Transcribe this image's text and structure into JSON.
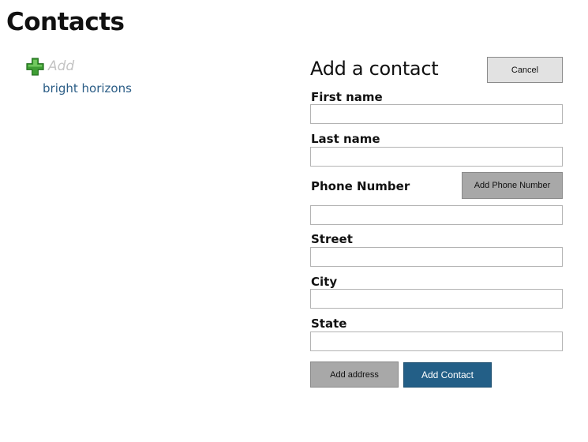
{
  "page": {
    "title": "Contacts"
  },
  "sidebar": {
    "add_label": "Add",
    "contacts": [
      "bright horizons"
    ]
  },
  "form": {
    "title": "Add a contact",
    "cancel_label": "Cancel",
    "first_name_label": "First name",
    "first_name_value": "",
    "last_name_label": "Last name",
    "last_name_value": "",
    "phone_label": "Phone Number",
    "phone_value": "",
    "add_phone_label": "Add Phone Number",
    "street_label": "Street",
    "street_value": "",
    "city_label": "City",
    "city_value": "",
    "state_label": "State",
    "state_value": "",
    "add_address_label": "Add address",
    "add_contact_label": "Add Contact"
  },
  "colors": {
    "link": "#2b5d86",
    "primary_button": "#235f87",
    "secondary_button": "#a8a8a8",
    "cancel_button": "#e2e2e2",
    "plus_icon": "#3fa832",
    "add_label": "#c4c4c4"
  },
  "icons": {
    "add": "plus-icon"
  }
}
